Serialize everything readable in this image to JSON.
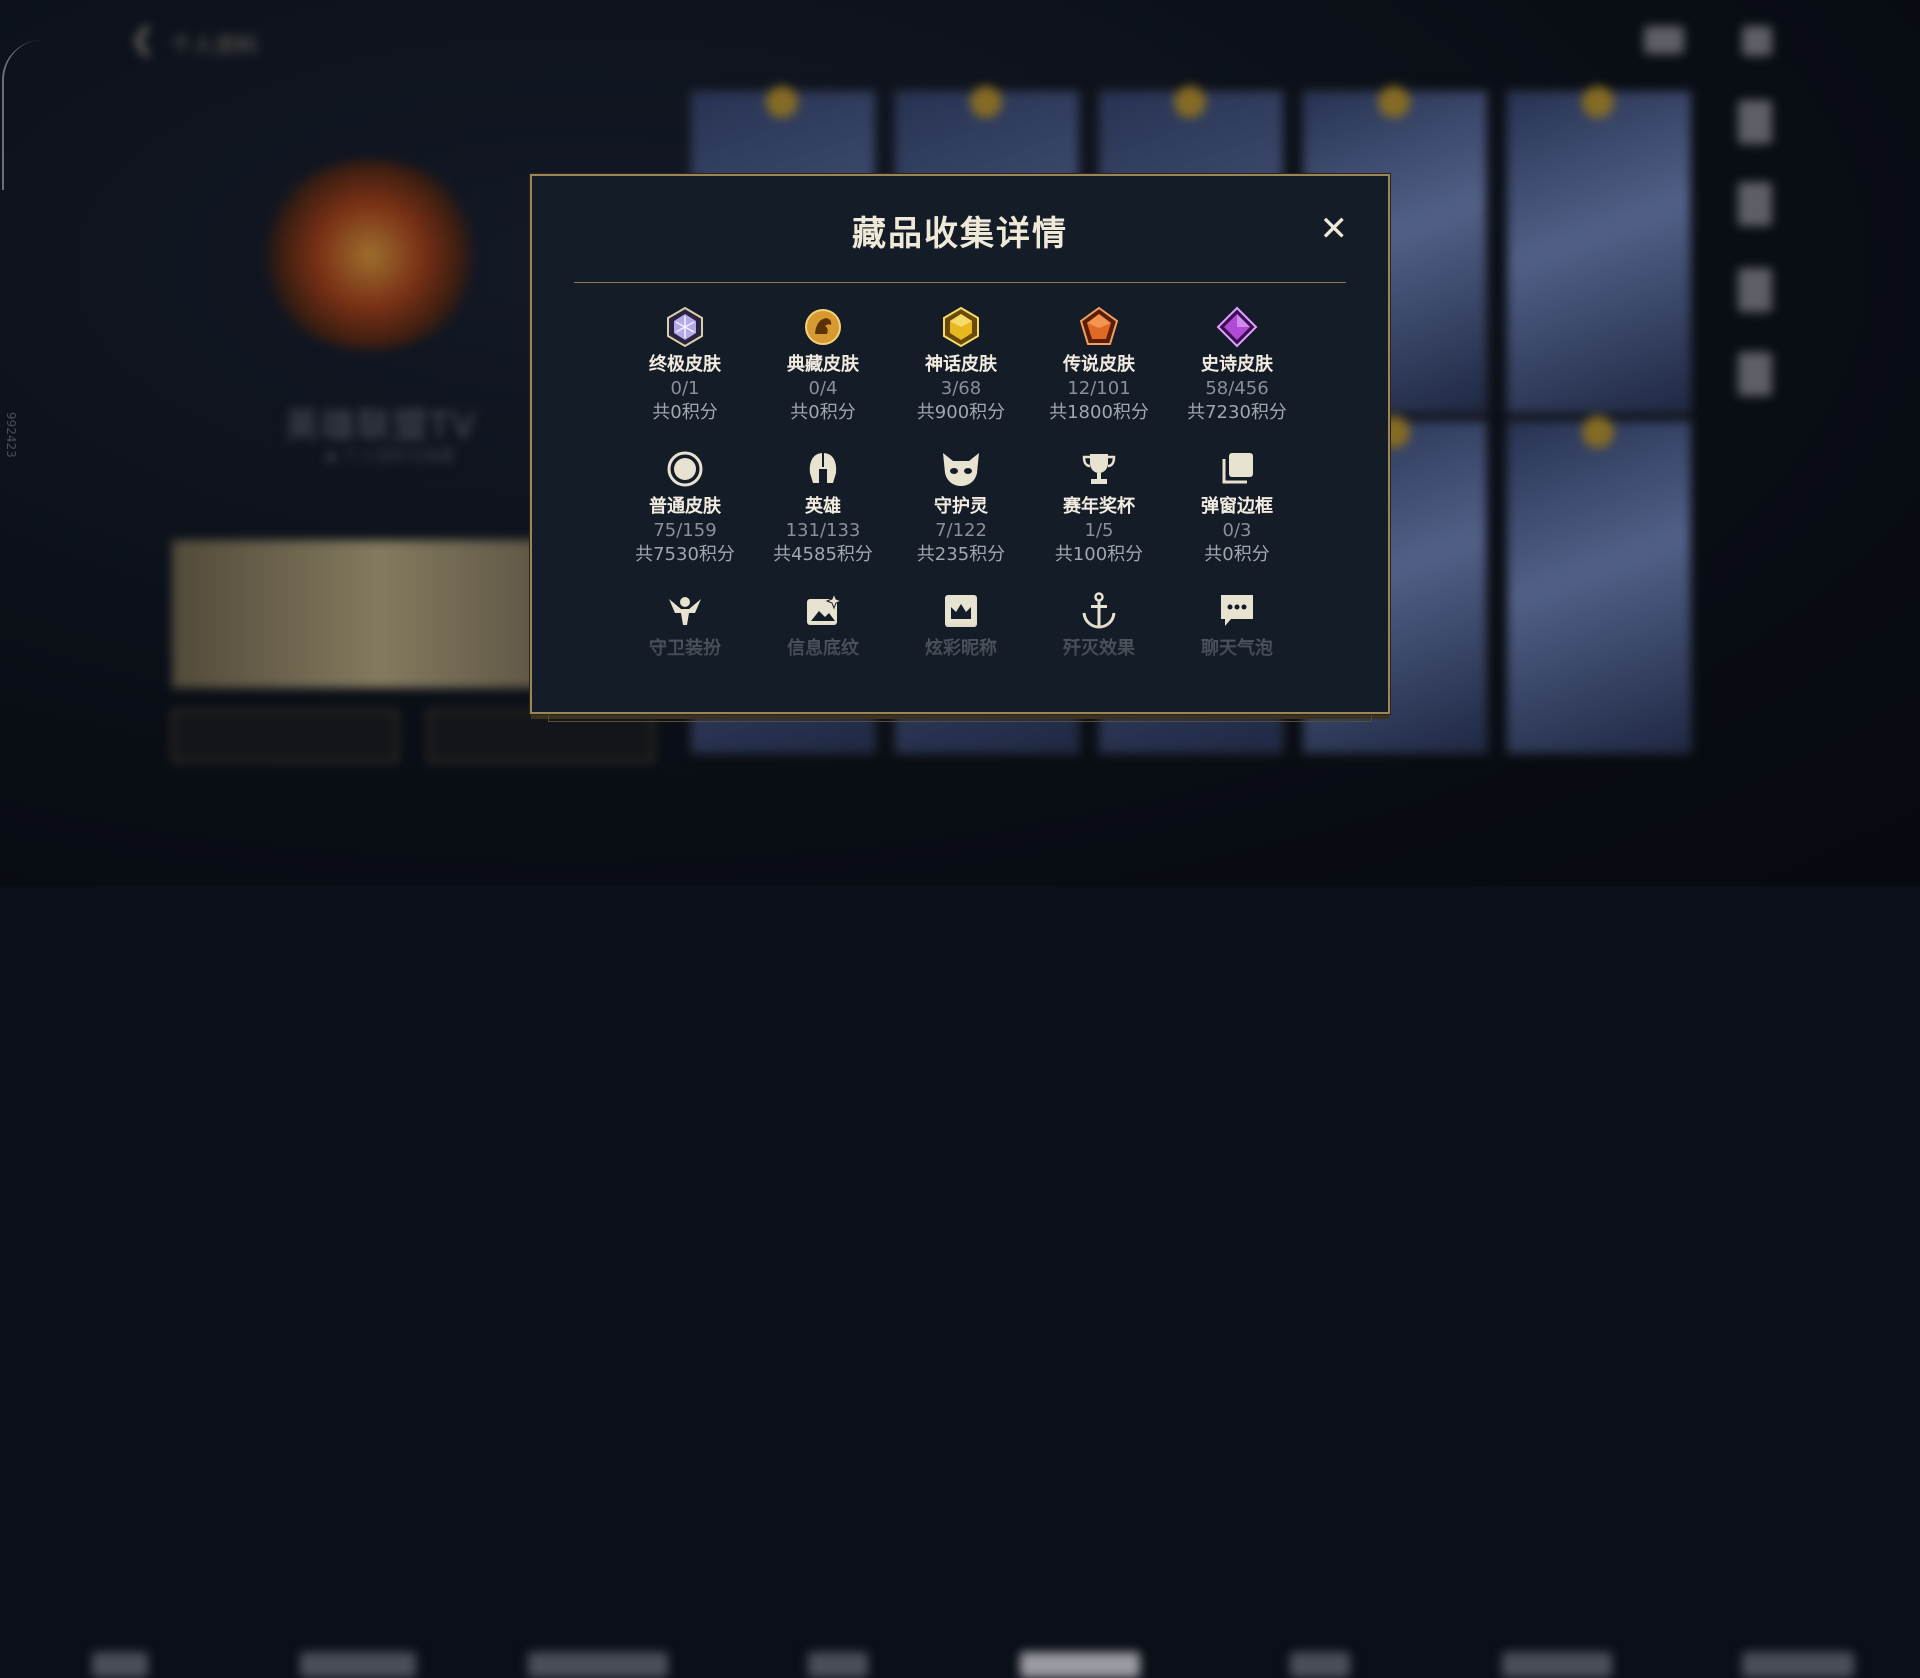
{
  "background": {
    "back_label": "个人资料",
    "player_name": "英雄联盟TV",
    "player_sub": "◆ 个人资料与收藏",
    "edge_text": "992423"
  },
  "modal": {
    "title": "藏品收集详情",
    "close_symbol": "✕",
    "rows": [
      [
        {
          "icon": "ultimate-skin-icon",
          "label": "终极皮肤",
          "count": "0/1",
          "points": "共0积分",
          "color": "#b7a8e8"
        },
        {
          "icon": "exalted-skin-icon",
          "label": "典藏皮肤",
          "count": "0/4",
          "points": "共0积分",
          "color": "#d89a30"
        },
        {
          "icon": "mythic-skin-icon",
          "label": "神话皮肤",
          "count": "3/68",
          "points": "共900积分",
          "color": "#e8b820"
        },
        {
          "icon": "legendary-skin-icon",
          "label": "传说皮肤",
          "count": "12/101",
          "points": "共1800积分",
          "color": "#e06a24"
        },
        {
          "icon": "epic-skin-icon",
          "label": "史诗皮肤",
          "count": "58/456",
          "points": "共7230积分",
          "color": "#b24ad8"
        }
      ],
      [
        {
          "icon": "standard-skin-icon",
          "label": "普通皮肤",
          "count": "75/159",
          "points": "共7530积分",
          "color": "#e8e2d0"
        },
        {
          "icon": "champion-helmet-icon",
          "label": "英雄",
          "count": "131/133",
          "points": "共4585积分",
          "color": "#e8e2d0"
        },
        {
          "icon": "spirit-companion-icon",
          "label": "守护灵",
          "count": "7/122",
          "points": "共235积分",
          "color": "#e8e2d0"
        },
        {
          "icon": "trophy-icon",
          "label": "赛年奖杯",
          "count": "1/5",
          "points": "共100积分",
          "color": "#e8e2d0"
        },
        {
          "icon": "popup-frame-icon",
          "label": "弹窗边框",
          "count": "0/3",
          "points": "共0积分",
          "color": "#e8e2d0"
        }
      ],
      [
        {
          "icon": "ward-skin-icon",
          "label": "守卫装扮",
          "color": "#e8e2d0"
        },
        {
          "icon": "info-banner-icon",
          "label": "信息底纹",
          "color": "#e8e2d0"
        },
        {
          "icon": "name-plate-icon",
          "label": "炫彩昵称",
          "color": "#e8e2d0"
        },
        {
          "icon": "anchor-icon",
          "label": "歼灭效果",
          "color": "#e8e2d0"
        },
        {
          "icon": "chat-bubble-icon",
          "label": "聊天气泡",
          "color": "#e8e2d0"
        }
      ]
    ]
  }
}
